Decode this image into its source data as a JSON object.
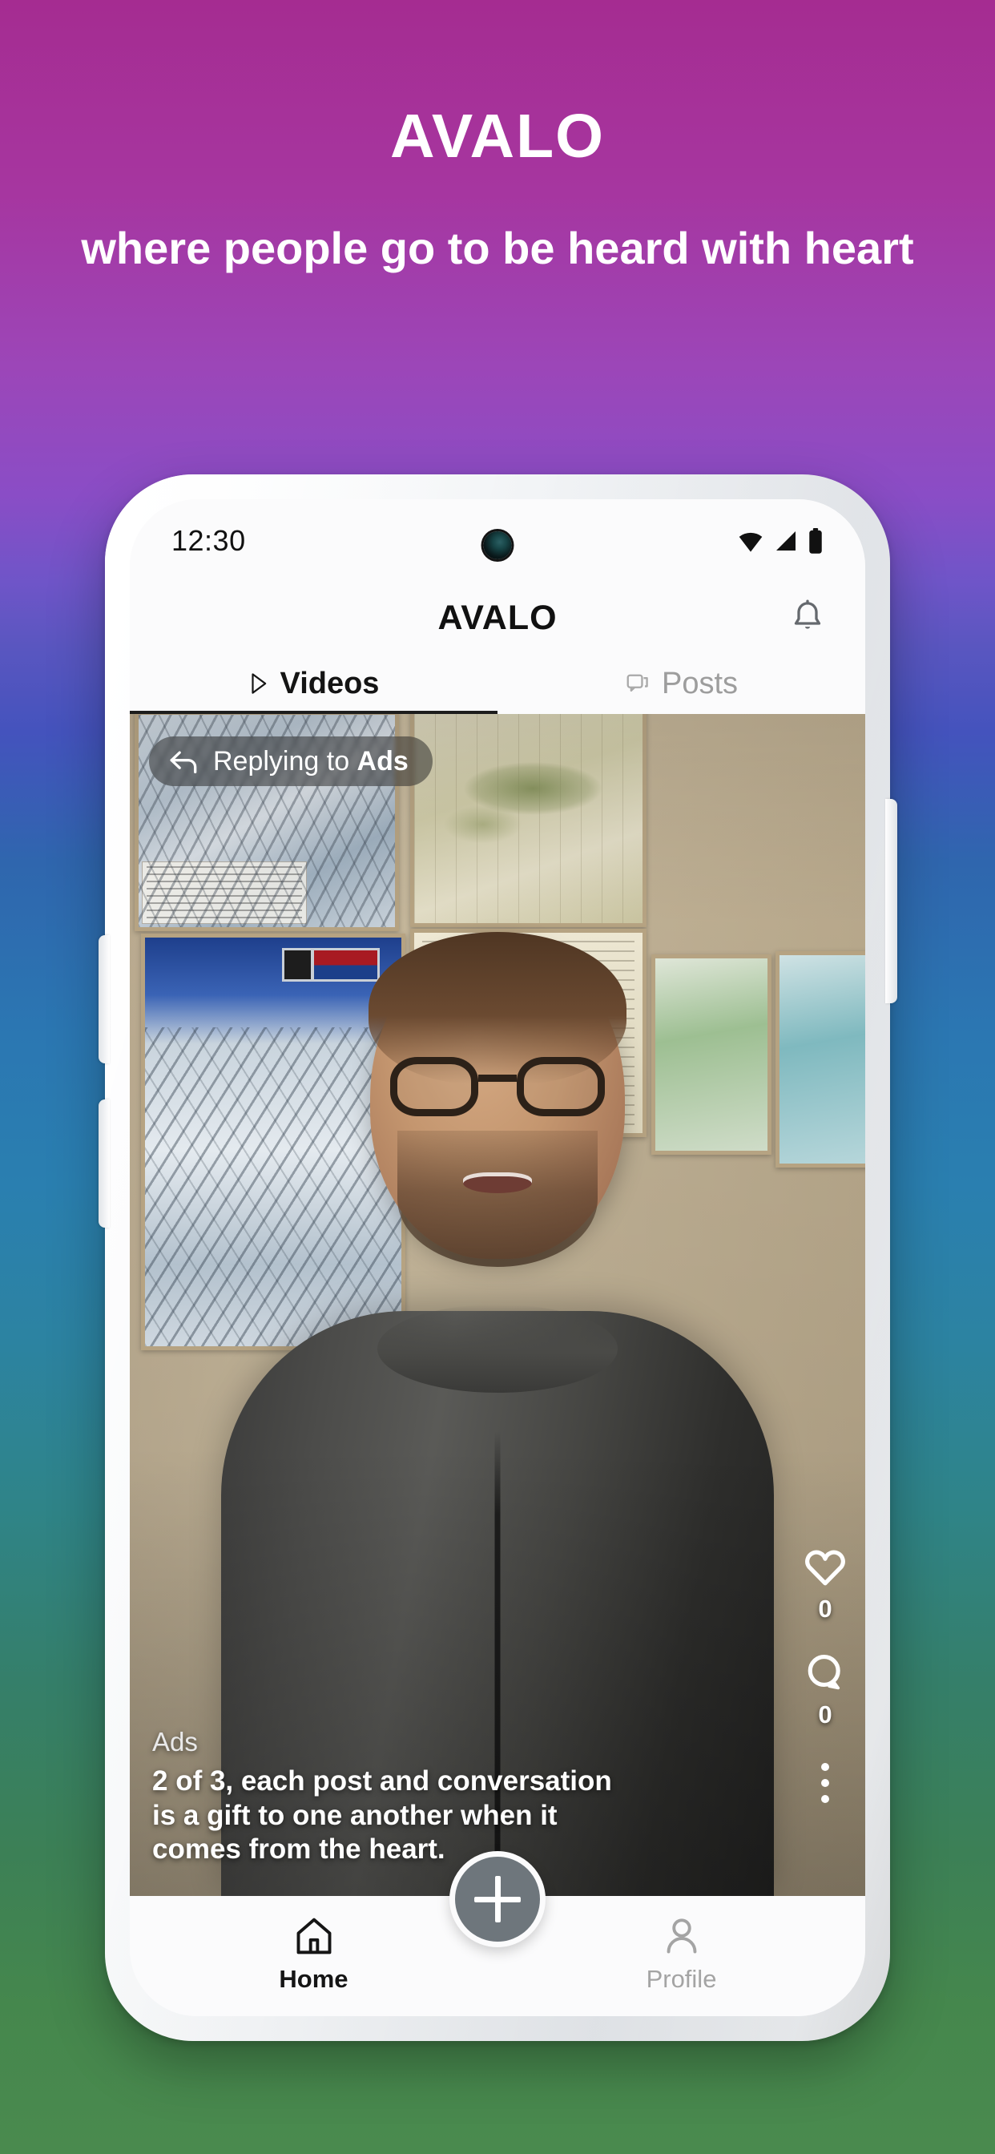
{
  "promo": {
    "title": "AVALO",
    "tagline": "where people go to be heard with heart",
    "gradient_top": "#a52c91",
    "gradient_mid": "#2b77b2",
    "gradient_bottom": "#4a8a4e"
  },
  "phone": {
    "status_bar": {
      "time": "12:30",
      "icons": [
        "wifi-icon",
        "cellular-signal-icon",
        "battery-icon"
      ]
    },
    "app_bar": {
      "title": "AVALO",
      "notifications_icon": "bell-icon"
    },
    "tabs": [
      {
        "label": "Videos",
        "icon": "play-triangle-icon",
        "active": true
      },
      {
        "label": "Posts",
        "icon": "chat-bubble-icon",
        "active": false
      }
    ],
    "video": {
      "reply_pill": {
        "icon": "reply-arrow-icon",
        "prefix": "Replying to ",
        "target": "Ads"
      },
      "caption": {
        "author": "Ads",
        "text": "2 of 3, each post and conversation is a gift to one another when it comes from the heart."
      },
      "actions": [
        {
          "icon": "heart-icon",
          "count": "0"
        },
        {
          "icon": "comment-icon",
          "count": "0"
        },
        {
          "icon": "more-vertical-icon",
          "count": ""
        }
      ]
    },
    "bottom_nav": {
      "items": [
        {
          "label": "Home",
          "icon": "home-icon",
          "active": true
        },
        {
          "label": "Profile",
          "icon": "person-icon",
          "active": false
        }
      ],
      "create_button": {
        "icon": "plus-icon",
        "color": "#6e767c"
      }
    }
  }
}
